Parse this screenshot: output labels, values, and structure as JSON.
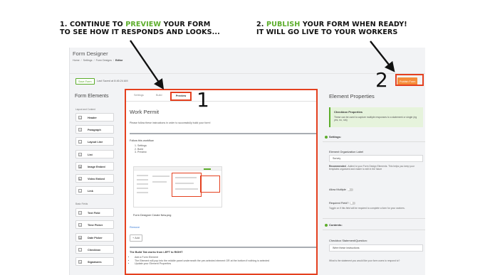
{
  "captions": {
    "step1_prefix": "1. CONTINUE TO ",
    "step1_highlight": "PREVIEW",
    "step1_rest_line1": " YOUR FORM",
    "step1_line2": "TO SEE HOW IT RESPONDS AND LOOKS...",
    "step2_prefix": "2. ",
    "step2_highlight": "PUBLISH",
    "step2_rest_line1": " YOUR FORM WHEN READY!",
    "step2_line2": "IT WILL GO LIVE TO YOUR WORKERS",
    "num1": "1",
    "num2": "2",
    "highlight_color": "#5cad2b"
  },
  "app": {
    "title": "Form Designer",
    "breadcrumb": [
      "Home",
      "Settings",
      "Form Designs",
      "Editor"
    ],
    "save_label": "Save Form",
    "last_saved": "Last Saved at 8:46:24 AM",
    "publish_label": "Publish Form",
    "accent": "#f58c3a"
  },
  "left": {
    "title": "Form Elements",
    "group1": "Layout and Content",
    "group2": "Basic Fields",
    "items1": [
      "Header",
      "Paragraph",
      "Layout Line",
      "List",
      "Image Embed",
      "Video Embed",
      "Link"
    ],
    "items2": [
      "Text Field",
      "Time Picker",
      "Date Picker",
      "Checkbox",
      "Signatures"
    ]
  },
  "middle": {
    "tabs": [
      "Settings",
      "Build",
      "Preview"
    ],
    "active_tab": "Preview",
    "form_title": "Work Permit",
    "description": "Please follow these instructions in order to successfully build your form!",
    "workflow_title": "Follow this workflow",
    "workflow_steps": [
      "1. Settings",
      "2. Build",
      "3. Preview"
    ],
    "image_caption": "Form Designer Create New.png",
    "remove_label": "Remove",
    "add_label": "+ Add",
    "build_title": "The Build Tab works from LEFT to RIGHT",
    "build_steps": [
      "Add a Form Element",
      "The Element will pop into the middle panel underneath the pre-selected element OR at the bottom if nothing is selected",
      "Update your Element Properties"
    ]
  },
  "right": {
    "title": "Element Properties",
    "info_title": "Checkbox Properties",
    "info_desc": "These can be used to capture multiple responses to a statement or single (eg yes, no, n/a)",
    "settings_header": "Settings:",
    "org_label": "Element Organization Label",
    "org_value": "Survey",
    "org_help_bold": "Recommended",
    "org_help": " - Added to your Form Design Elements. This helps you keep your templates organized and easier to edit in the future",
    "allow_multiple": "Allow Multiple",
    "required_label": "Required Field?",
    "required_help": "Toggle on if this field will be required to complete a form for your workers.",
    "contents_header": "Contents:",
    "statement_label": "Checkbox Statement/Question:",
    "statement_value": "Were these instructions",
    "statement_help": "What is the statement you would like your form users to respond to?"
  }
}
